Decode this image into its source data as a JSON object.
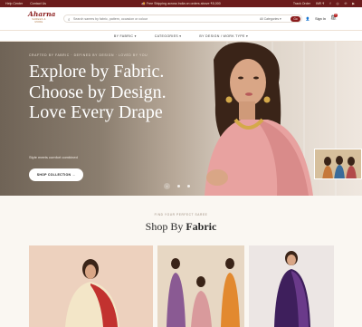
{
  "topbar": {
    "left_links": [
      "Help Center",
      "Contact Us"
    ],
    "announcement": "🚚 Free Shipping across India on orders above ₹5,000",
    "track": "Track Order",
    "currency": "INR ₹",
    "social_icons": [
      "facebook-icon",
      "instagram-icon",
      "pinterest-icon",
      "youtube-icon"
    ]
  },
  "header": {
    "logo_text": "Aharna",
    "logo_sub": "SAREES & MORE",
    "search_placeholder": "Search sarees by fabric, pattern, occasion or colour",
    "category_select": "All Categories",
    "search_button": "Go",
    "signin": "Sign In",
    "cart_count": "0"
  },
  "nav": [
    "BY FABRIC",
    "CATEGORIES",
    "BY DESIGN / WORK TYPE"
  ],
  "hero": {
    "kicker": "CRAFTED BY FABRIC · DEFINED BY DESIGN · LOVED BY YOU",
    "headline": "Explore by Fabric. Choose by Design. Love Every Drape",
    "tagline": "Style meets comfort combined",
    "cta": "SHOP COLLECTION  →"
  },
  "section": {
    "kicker": "FIND YOUR PERFECT SAREE",
    "title_prefix": "Shop By",
    "title_bold": "Fabric"
  },
  "colors": {
    "brand": "#8b1d1d",
    "topbar_bg": "#6b1c1c",
    "page_bg": "#faf7f2"
  }
}
